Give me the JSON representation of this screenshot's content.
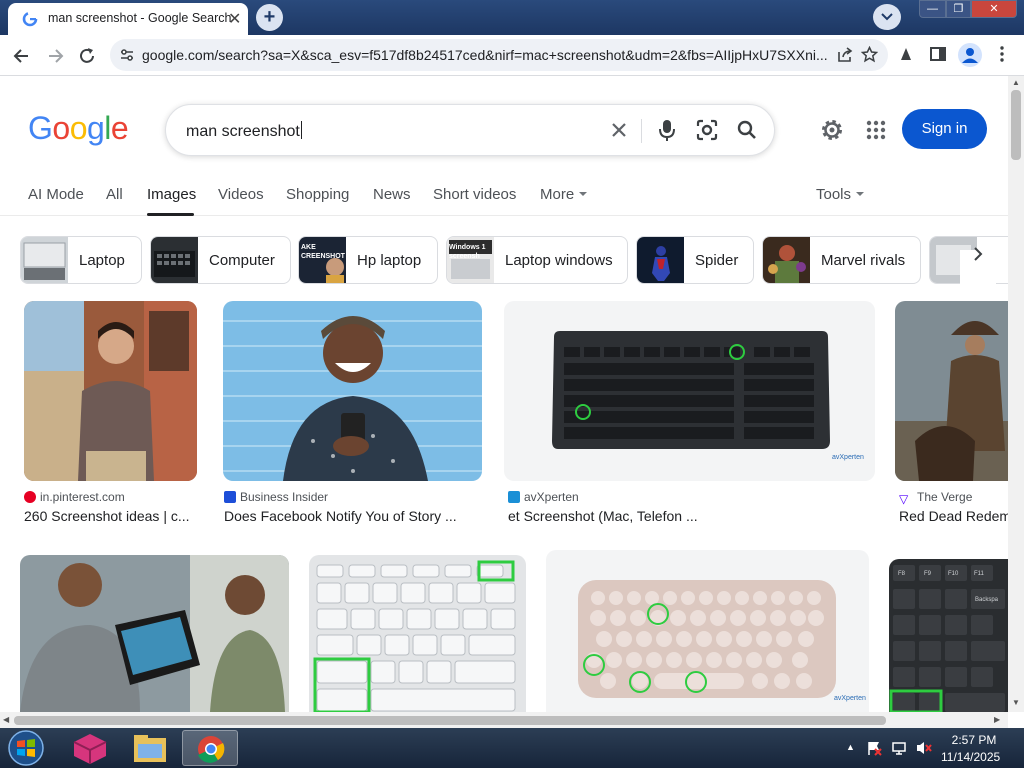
{
  "browser": {
    "tab_title": "man screenshot - Google Search",
    "tab_close": "✕",
    "new_tab": "+",
    "url": "google.com/search?sa=X&sca_esv=f517df8b24517ced&nirf=mac+screenshot&udm=2&fbs=AIIjpHxU7SXXni...",
    "win_min": "—",
    "win_max": "❐",
    "win_close": "✕"
  },
  "search": {
    "logo": [
      "G",
      "o",
      "o",
      "g",
      "l",
      "e"
    ],
    "logo_colors": [
      "#4285F4",
      "#EA4335",
      "#FBBC05",
      "#4285F4",
      "#34A853",
      "#EA4335"
    ],
    "query": "man screenshot",
    "signin": "Sign in"
  },
  "nav": {
    "tabs": [
      "AI Mode",
      "All",
      "Images",
      "Videos",
      "Shopping",
      "News",
      "Short videos",
      "More"
    ],
    "active": "Images",
    "tools": "Tools"
  },
  "chips": [
    {
      "label": "Laptop"
    },
    {
      "label": "Computer"
    },
    {
      "label": "Hp laptop",
      "thumb_text": "AKE\nCREENSHOT"
    },
    {
      "label": "Laptop windows",
      "thumb_text": "Windows 1\nscreensh"
    },
    {
      "label": "Spider"
    },
    {
      "label": "Marvel rivals"
    }
  ],
  "results": [
    {
      "source": "in.pinterest.com",
      "title": "260 Screenshot ideas | c...",
      "source_color": "#E60023"
    },
    {
      "source": "Business Insider",
      "title": "Does Facebook Notify You of Story ...",
      "source_color": "#1d4ed8"
    },
    {
      "source": "avXperten",
      "title": "et Screenshot (Mac, Telefon ...",
      "source_color": "#1a8fd6",
      "watermark": "avXperten"
    },
    {
      "source": "The Verge",
      "title": "Red Dead Redem",
      "source_color": "#5200ff"
    }
  ],
  "results_row2": [
    {
      "watermark": ""
    },
    {
      "watermark": ""
    },
    {
      "watermark": "avXperten"
    },
    {
      "keys": [
        "F8",
        "F9",
        "F10",
        "F11",
        "Backspa"
      ]
    }
  ],
  "taskbar": {
    "time": "2:57 PM",
    "date": "11/14/2025"
  }
}
